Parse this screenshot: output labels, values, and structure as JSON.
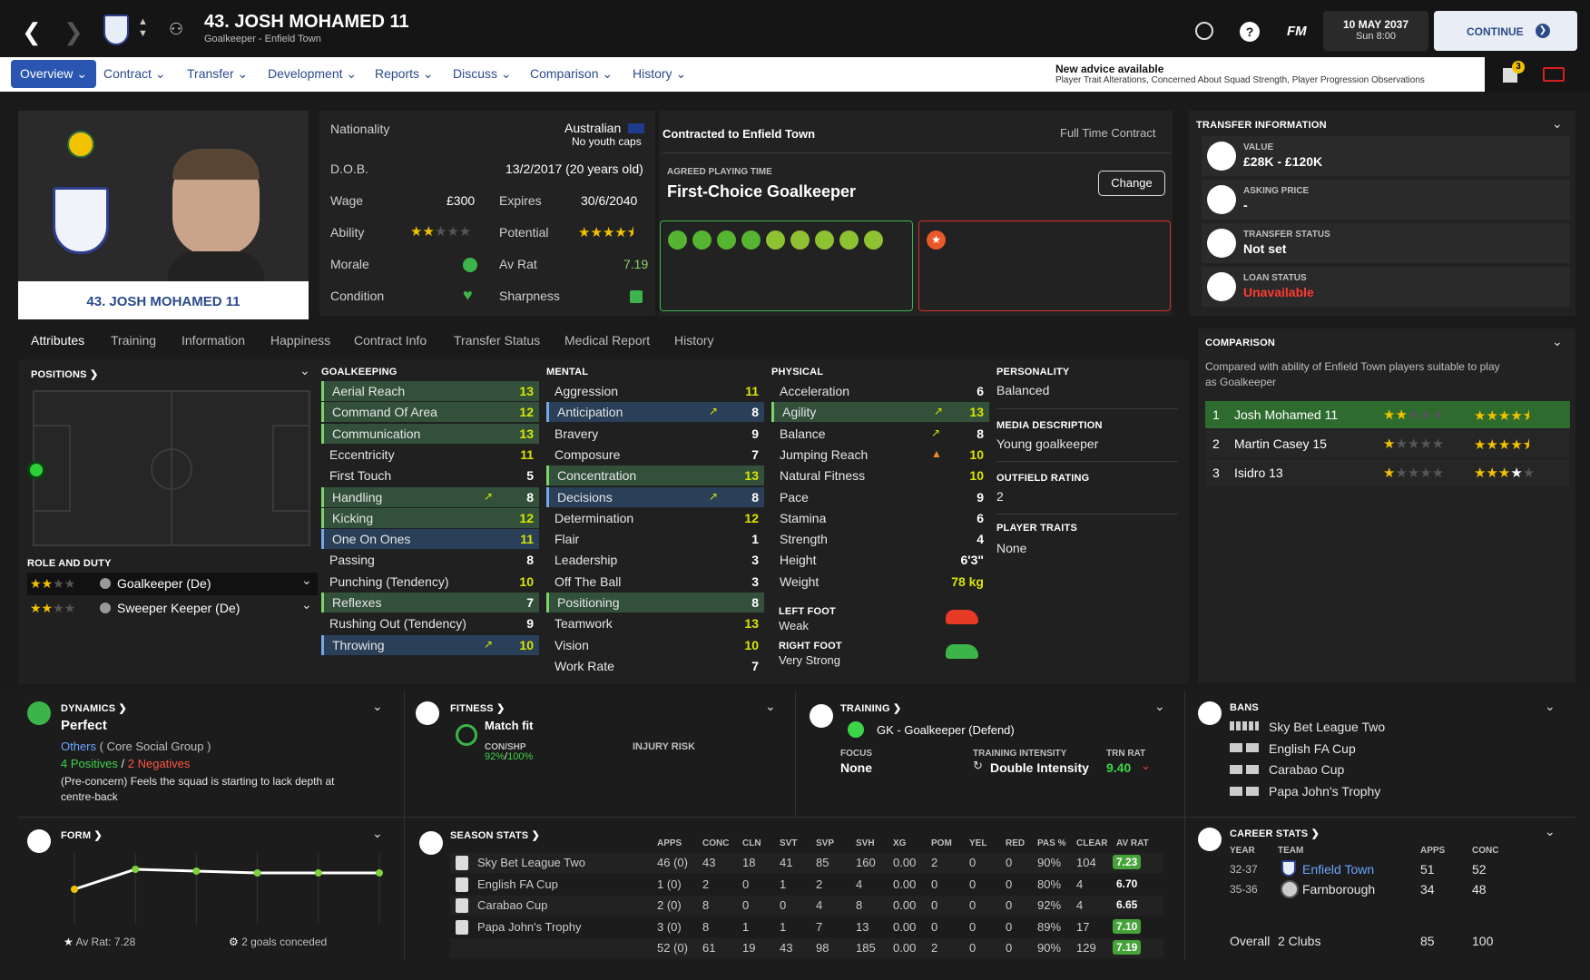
{
  "header": {
    "title": "43. JOSH MOHAMED 11",
    "subtitle": "Goalkeeper - Enfield Town",
    "date": "10 MAY 2037",
    "time": "Sun 8:00",
    "continue": "CONTINUE",
    "fm": "FM",
    "help": "?"
  },
  "nav": {
    "items": [
      "Overview",
      "Contract",
      "Transfer",
      "Development",
      "Reports",
      "Discuss",
      "Comparison",
      "History"
    ]
  },
  "advice": {
    "title": "New advice available",
    "text": "Player Trait Alterations, Concerned About Squad Strength, Player Progression Observations",
    "badge": "3"
  },
  "player_card": {
    "name": "43. JOSH MOHAMED 11",
    "crest_text": "ENFIELD TOWN FC"
  },
  "details": {
    "nationality_label": "Nationality",
    "nationality": "Australian",
    "caps": "No youth caps",
    "dob_label": "D.O.B.",
    "dob": "13/2/2017 (20 years old)",
    "wage_label": "Wage",
    "wage": "£300",
    "expires_label": "Expires",
    "expires": "30/6/2040",
    "ability_label": "Ability",
    "potential_label": "Potential",
    "morale_label": "Morale",
    "avrat_label": "Av Rat",
    "avrat": "7.19",
    "condition_label": "Condition",
    "sharpness_label": "Sharpness",
    "ability_stars": 2,
    "potential_stars": 4.5
  },
  "contract": {
    "title": "Contracted to Enfield Town",
    "type": "Full Time Contract",
    "agreed_label": "AGREED PLAYING TIME",
    "agreed": "First-Choice Goalkeeper",
    "change": "Change"
  },
  "transfer_info": {
    "title": "TRANSFER INFORMATION",
    "value_label": "VALUE",
    "value": "£28K - £120K",
    "asking_label": "ASKING PRICE",
    "asking": "-",
    "status_label": "TRANSFER STATUS",
    "status": "Not set",
    "loan_label": "LOAN STATUS",
    "loan": "Unavailable"
  },
  "comparison": {
    "title": "COMPARISON",
    "desc": "Compared with ability of Enfield Town players suitable to play as Goalkeeper",
    "rows": [
      {
        "n": "1",
        "name": "Josh Mohamed 11",
        "ab": 2,
        "pot": 4.5
      },
      {
        "n": "2",
        "name": "Martin Casey 15",
        "ab": 1,
        "pot": 4.5
      },
      {
        "n": "3",
        "name": "Isidro 13",
        "ab": 1,
        "pot": 4
      }
    ]
  },
  "tabs": [
    "Attributes",
    "Training",
    "Information",
    "Happiness",
    "Contract Info",
    "Transfer Status",
    "Medical Report",
    "History"
  ],
  "positions": {
    "title": "POSITIONS",
    "role_title": "ROLE AND DUTY",
    "roles": [
      "Goalkeeper (De)",
      "Sweeper Keeper (De)"
    ]
  },
  "goalkeeping": {
    "title": "GOALKEEPING",
    "rows": [
      [
        "Aerial Reach",
        "13"
      ],
      [
        "Command Of Area",
        "12"
      ],
      [
        "Communication",
        "13"
      ],
      [
        "Eccentricity",
        "11"
      ],
      [
        "First Touch",
        "5"
      ],
      [
        "Handling",
        "8"
      ],
      [
        "Kicking",
        "12"
      ],
      [
        "One On Ones",
        "11"
      ],
      [
        "Passing",
        "8"
      ],
      [
        "Punching (Tendency)",
        "10"
      ],
      [
        "Reflexes",
        "7"
      ],
      [
        "Rushing Out (Tendency)",
        "9"
      ],
      [
        "Throwing",
        "10"
      ]
    ]
  },
  "mental": {
    "title": "MENTAL",
    "rows": [
      [
        "Aggression",
        "11"
      ],
      [
        "Anticipation",
        "8"
      ],
      [
        "Bravery",
        "9"
      ],
      [
        "Composure",
        "7"
      ],
      [
        "Concentration",
        "13"
      ],
      [
        "Decisions",
        "8"
      ],
      [
        "Determination",
        "12"
      ],
      [
        "Flair",
        "1"
      ],
      [
        "Leadership",
        "3"
      ],
      [
        "Off The Ball",
        "3"
      ],
      [
        "Positioning",
        "8"
      ],
      [
        "Teamwork",
        "13"
      ],
      [
        "Vision",
        "10"
      ],
      [
        "Work Rate",
        "7"
      ]
    ]
  },
  "physical": {
    "title": "PHYSICAL",
    "rows": [
      [
        "Acceleration",
        "6"
      ],
      [
        "Agility",
        "13"
      ],
      [
        "Balance",
        "8"
      ],
      [
        "Jumping Reach",
        "10"
      ],
      [
        "Natural Fitness",
        "10"
      ],
      [
        "Pace",
        "9"
      ],
      [
        "Stamina",
        "6"
      ],
      [
        "Strength",
        "4"
      ],
      [
        "Height",
        "6'3\""
      ],
      [
        "Weight",
        "78 kg"
      ]
    ],
    "left_foot_label": "LEFT FOOT",
    "left_foot": "Weak",
    "right_foot_label": "RIGHT FOOT",
    "right_foot": "Very Strong"
  },
  "personality": {
    "title": "PERSONALITY",
    "value": "Balanced",
    "media_title": "MEDIA DESCRIPTION",
    "media": "Young goalkeeper",
    "outfield_title": "OUTFIELD RATING",
    "outfield": "2",
    "traits_title": "PLAYER TRAITS",
    "traits": "None"
  },
  "dynamics": {
    "title": "DYNAMICS",
    "value": "Perfect",
    "group": "Others",
    "group_suffix": "( Core Social Group )",
    "pos": "4 Positives",
    "slash": "/",
    "neg": "2 Negatives",
    "note": "(Pre-concern) Feels the squad is starting to lack depth at centre-back"
  },
  "fitness": {
    "title": "FITNESS",
    "status": "Match fit",
    "conshp": "CON/SHP",
    "con": "92%",
    "sep": "/",
    "shp": "100%",
    "injury": "INJURY RISK"
  },
  "training": {
    "title": "TRAINING",
    "role": "GK - Goalkeeper (Defend)",
    "focus_label": "FOCUS",
    "focus": "None",
    "intensity_label": "TRAINING INTENSITY",
    "intensity": "Double Intensity",
    "trn_label": "TRN RAT",
    "trn": "9.40"
  },
  "bans": {
    "title": "BANS",
    "items": [
      "Sky Bet League Two",
      "English FA Cup",
      "Carabao Cup",
      "Papa John's Trophy"
    ]
  },
  "form": {
    "title": "FORM",
    "avrat": "Av Rat: 7.28",
    "conceded": "2 goals conceded",
    "points": [
      7.1,
      7.32,
      7.3,
      7.28,
      7.28,
      7.28
    ]
  },
  "season": {
    "title": "SEASON STATS",
    "cols": [
      "APPS",
      "CONC",
      "CLN",
      "SVT",
      "SVP",
      "SVH",
      "XG",
      "POM",
      "YEL",
      "RED",
      "PAS %",
      "CLEAR",
      "AV RAT"
    ],
    "rows": [
      {
        "comp": "Sky Bet League Two",
        "v": [
          "46 (0)",
          "43",
          "18",
          "41",
          "85",
          "160",
          "0.00",
          "2",
          "0",
          "0",
          "90%",
          "104"
        ],
        "rat": "7.23",
        "g": true
      },
      {
        "comp": "English FA Cup",
        "v": [
          "1 (0)",
          "2",
          "0",
          "1",
          "2",
          "4",
          "0.00",
          "0",
          "0",
          "0",
          "80%",
          "4"
        ],
        "rat": "6.70",
        "g": false
      },
      {
        "comp": "Carabao Cup",
        "v": [
          "2 (0)",
          "8",
          "0",
          "0",
          "4",
          "8",
          "0.00",
          "0",
          "0",
          "0",
          "92%",
          "4"
        ],
        "rat": "6.65",
        "g": false
      },
      {
        "comp": "Papa John's Trophy",
        "v": [
          "3 (0)",
          "8",
          "1",
          "1",
          "7",
          "13",
          "0.00",
          "0",
          "0",
          "0",
          "89%",
          "17"
        ],
        "rat": "7.10",
        "g": true
      },
      {
        "comp": "",
        "v": [
          "52 (0)",
          "61",
          "19",
          "43",
          "98",
          "185",
          "0.00",
          "2",
          "0",
          "0",
          "90%",
          "129"
        ],
        "rat": "7.19",
        "g": true
      }
    ]
  },
  "career": {
    "title": "CAREER STATS",
    "year_h": "YEAR",
    "team_h": "TEAM",
    "apps_h": "APPS",
    "conc_h": "CONC",
    "rows": [
      {
        "year": "32-37",
        "team": "Enfield Town",
        "apps": "51",
        "conc": "52",
        "link": true
      },
      {
        "year": "35-36",
        "team": "Farnborough",
        "apps": "34",
        "conc": "48",
        "link": false
      }
    ],
    "overall": "Overall",
    "clubs": "2 Clubs",
    "total_apps": "85",
    "total_conc": "100"
  }
}
